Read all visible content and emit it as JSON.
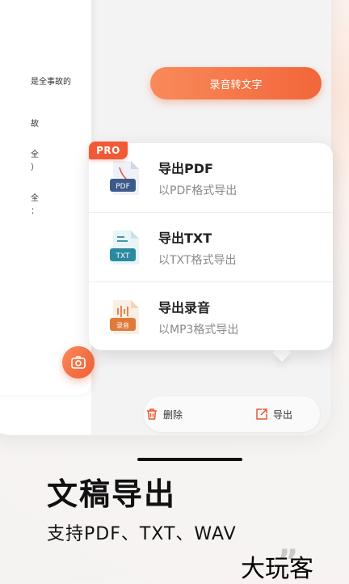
{
  "doc_panel": {
    "lines": [
      "是全事故的",
      "故",
      "全",
      "）",
      "全",
      "："
    ]
  },
  "transcribe_button": {
    "label": "录音转文字"
  },
  "export_menu": {
    "pro_badge": "PRO",
    "items": [
      {
        "title": "导出PDF",
        "subtitle": "以PDF格式导出",
        "icon_label": "PDF",
        "icon": "pdf-file-icon"
      },
      {
        "title": "导出TXT",
        "subtitle": "以TXT格式导出",
        "icon_label": "TXT",
        "icon": "txt-file-icon"
      },
      {
        "title": "导出录音",
        "subtitle": "以MP3格式导出",
        "icon_label": "录音",
        "icon": "audio-file-icon"
      }
    ]
  },
  "action_bar": {
    "delete_label": "删除",
    "export_label": "导出"
  },
  "headline": "文稿导出",
  "subline": "支持PDF、TXT、WAV",
  "watermark": "大玩客",
  "colors": {
    "accent": "#f2663b",
    "pro": "#f15a36",
    "pdf_icon": "#3c5a8a",
    "txt_icon": "#2a8aa0",
    "audio_icon": "#e07a3a"
  }
}
